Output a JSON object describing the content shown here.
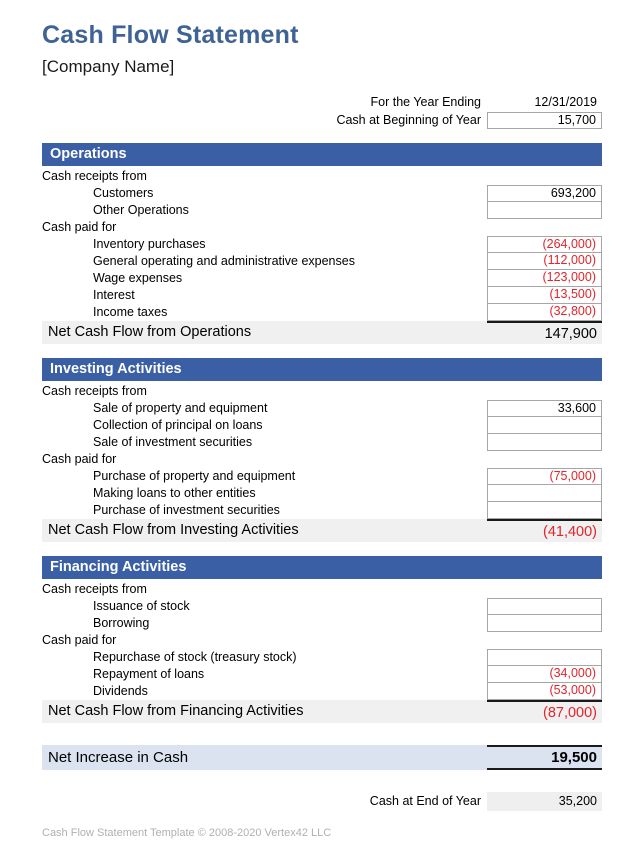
{
  "document": {
    "title": "Cash Flow Statement",
    "company": "[Company Name]"
  },
  "meta": {
    "year_ending_label": "For the Year Ending",
    "year_ending_value": "12/31/2019",
    "cash_beginning_label": "Cash at Beginning of Year",
    "cash_beginning_value": "15,700"
  },
  "sections": [
    {
      "header": "Operations",
      "rows": [
        {
          "label": "Cash receipts from",
          "indent": false,
          "value": "",
          "box": false,
          "negative": false
        },
        {
          "label": "Customers",
          "indent": true,
          "value": "693,200",
          "box": true,
          "negative": false
        },
        {
          "label": "Other Operations",
          "indent": true,
          "value": "",
          "box": true,
          "negative": false
        },
        {
          "label": "Cash paid for",
          "indent": false,
          "value": "",
          "box": false,
          "negative": false
        },
        {
          "label": "Inventory purchases",
          "indent": true,
          "value": "(264,000)",
          "box": true,
          "negative": true
        },
        {
          "label": "General operating and administrative expenses",
          "indent": true,
          "value": "(112,000)",
          "box": true,
          "negative": true
        },
        {
          "label": "Wage expenses",
          "indent": true,
          "value": "(123,000)",
          "box": true,
          "negative": true
        },
        {
          "label": "Interest",
          "indent": true,
          "value": "(13,500)",
          "box": true,
          "negative": true
        },
        {
          "label": "Income taxes",
          "indent": true,
          "value": "(32,800)",
          "box": true,
          "negative": true
        }
      ],
      "total_label": "Net Cash Flow from Operations",
      "total_value": "147,900",
      "total_negative": false
    },
    {
      "header": "Investing Activities",
      "rows": [
        {
          "label": "Cash receipts from",
          "indent": false,
          "value": "",
          "box": false,
          "negative": false
        },
        {
          "label": "Sale of property and equipment",
          "indent": true,
          "value": "33,600",
          "box": true,
          "negative": false
        },
        {
          "label": "Collection of principal on loans",
          "indent": true,
          "value": "",
          "box": true,
          "negative": false
        },
        {
          "label": "Sale of investment securities",
          "indent": true,
          "value": "",
          "box": true,
          "negative": false
        },
        {
          "label": "Cash paid for",
          "indent": false,
          "value": "",
          "box": false,
          "negative": false
        },
        {
          "label": "Purchase of property and equipment",
          "indent": true,
          "value": "(75,000)",
          "box": true,
          "negative": true
        },
        {
          "label": "Making loans to other entities",
          "indent": true,
          "value": "",
          "box": true,
          "negative": false
        },
        {
          "label": "Purchase of investment securities",
          "indent": true,
          "value": "",
          "box": true,
          "negative": false
        }
      ],
      "total_label": "Net Cash Flow from Investing Activities",
      "total_value": "(41,400)",
      "total_negative": true
    },
    {
      "header": "Financing Activities",
      "rows": [
        {
          "label": "Cash receipts from",
          "indent": false,
          "value": "",
          "box": false,
          "negative": false
        },
        {
          "label": "Issuance of stock",
          "indent": true,
          "value": "",
          "box": true,
          "negative": false
        },
        {
          "label": "Borrowing",
          "indent": true,
          "value": "",
          "box": true,
          "negative": false
        },
        {
          "label": "Cash paid for",
          "indent": false,
          "value": "",
          "box": false,
          "negative": false
        },
        {
          "label": "Repurchase of stock (treasury stock)",
          "indent": true,
          "value": "",
          "box": true,
          "negative": false
        },
        {
          "label": "Repayment of loans",
          "indent": true,
          "value": "(34,000)",
          "box": true,
          "negative": true
        },
        {
          "label": "Dividends",
          "indent": true,
          "value": "(53,000)",
          "box": true,
          "negative": true
        }
      ],
      "total_label": "Net Cash Flow from Financing Activities",
      "total_value": "(87,000)",
      "total_negative": true
    }
  ],
  "net_increase": {
    "label": "Net Increase in Cash",
    "value": "19,500"
  },
  "cash_end": {
    "label": "Cash at End of Year",
    "value": "35,200"
  },
  "footer": {
    "text": "Cash Flow Statement Template © 2008-2020 Vertex42 LLC"
  },
  "colors": {
    "title": "#3f6395",
    "section_header_bg": "#3b5fa5",
    "negative": "#e3242b",
    "total_bg": "#f0f0f0",
    "net_bg": "#dbe3f0",
    "end_bg": "#efefef"
  }
}
